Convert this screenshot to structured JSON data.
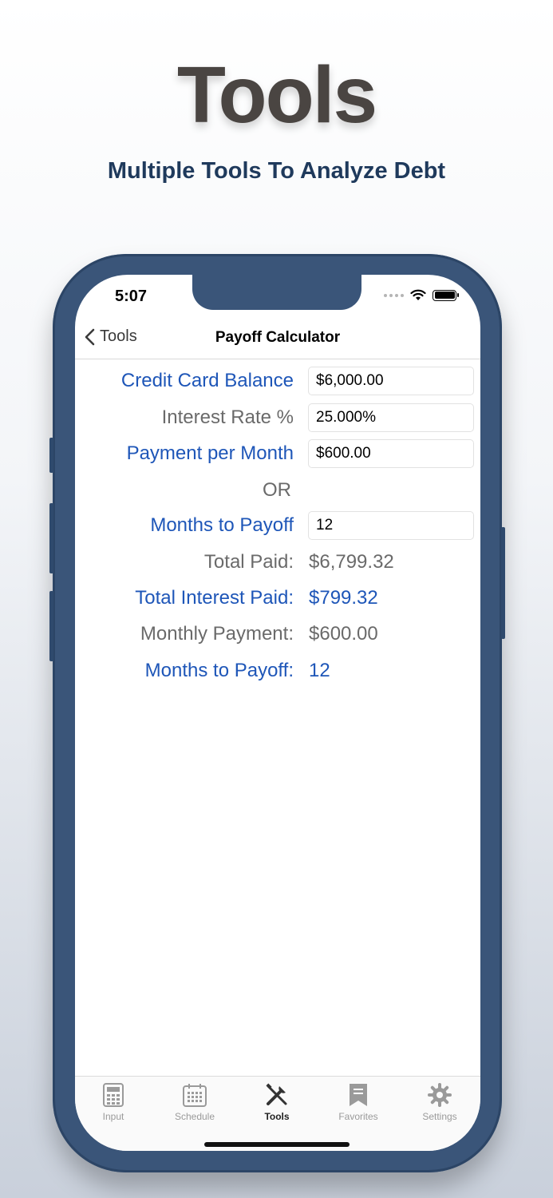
{
  "hero": {
    "title": "Tools",
    "subtitle": "Multiple Tools To Analyze Debt"
  },
  "status": {
    "time": "5:07"
  },
  "nav": {
    "back_label": "Tools",
    "title": "Payoff Calculator"
  },
  "form": {
    "balance_label": "Credit Card Balance",
    "balance_value": "$6,000.00",
    "rate_label": "Interest Rate %",
    "rate_value": "25.000%",
    "payment_label": "Payment per Month",
    "payment_value": "$600.00",
    "or_label": "OR",
    "months_label": "Months to Payoff",
    "months_value": "12"
  },
  "results": {
    "total_paid_label": "Total Paid:",
    "total_paid_value": "$6,799.32",
    "total_interest_label": "Total Interest Paid:",
    "total_interest_value": "$799.32",
    "monthly_payment_label": "Monthly Payment:",
    "monthly_payment_value": "$600.00",
    "months_label": "Months to Payoff:",
    "months_value": "12"
  },
  "tabs": [
    {
      "label": "Input",
      "icon": "calculator-icon"
    },
    {
      "label": "Schedule",
      "icon": "calendar-icon"
    },
    {
      "label": "Tools",
      "icon": "tools-icon"
    },
    {
      "label": "Favorites",
      "icon": "bookmark-icon"
    },
    {
      "label": "Settings",
      "icon": "gear-icon"
    }
  ],
  "colors": {
    "accent": "#1e56b8",
    "frame": "#3a5579",
    "heading": "#1f3a5c"
  }
}
